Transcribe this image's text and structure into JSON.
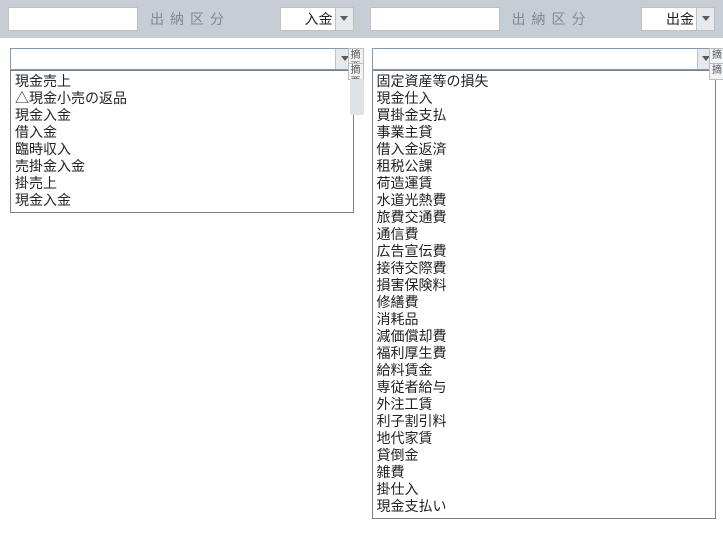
{
  "left": {
    "strip_label": "出納区分",
    "type_value": "入金",
    "side_tabs": [
      "摘要",
      "摘要"
    ],
    "items": [
      "現金売上",
      "△現金小売の返品",
      "現金入金",
      "借入金",
      "臨時収入",
      "売掛金入金",
      "掛売上",
      "現金入金"
    ]
  },
  "right": {
    "strip_label": "出納区分",
    "type_value": "出金",
    "side_tabs": [
      "摘",
      "摘"
    ],
    "items": [
      "固定資産等の損失",
      "現金仕入",
      "買掛金支払",
      "事業主貸",
      "借入金返済",
      "租税公課",
      "荷造運賃",
      "水道光熱費",
      "旅費交通費",
      "通信費",
      "広告宣伝費",
      "接待交際費",
      "損害保険料",
      "修繕費",
      "消耗品",
      "減価償却費",
      "福利厚生費",
      "給料賃金",
      "専従者給与",
      "外注工賃",
      "利子割引料",
      "地代家賃",
      "貸倒金",
      "雑費",
      "掛仕入",
      "現金支払い"
    ]
  }
}
